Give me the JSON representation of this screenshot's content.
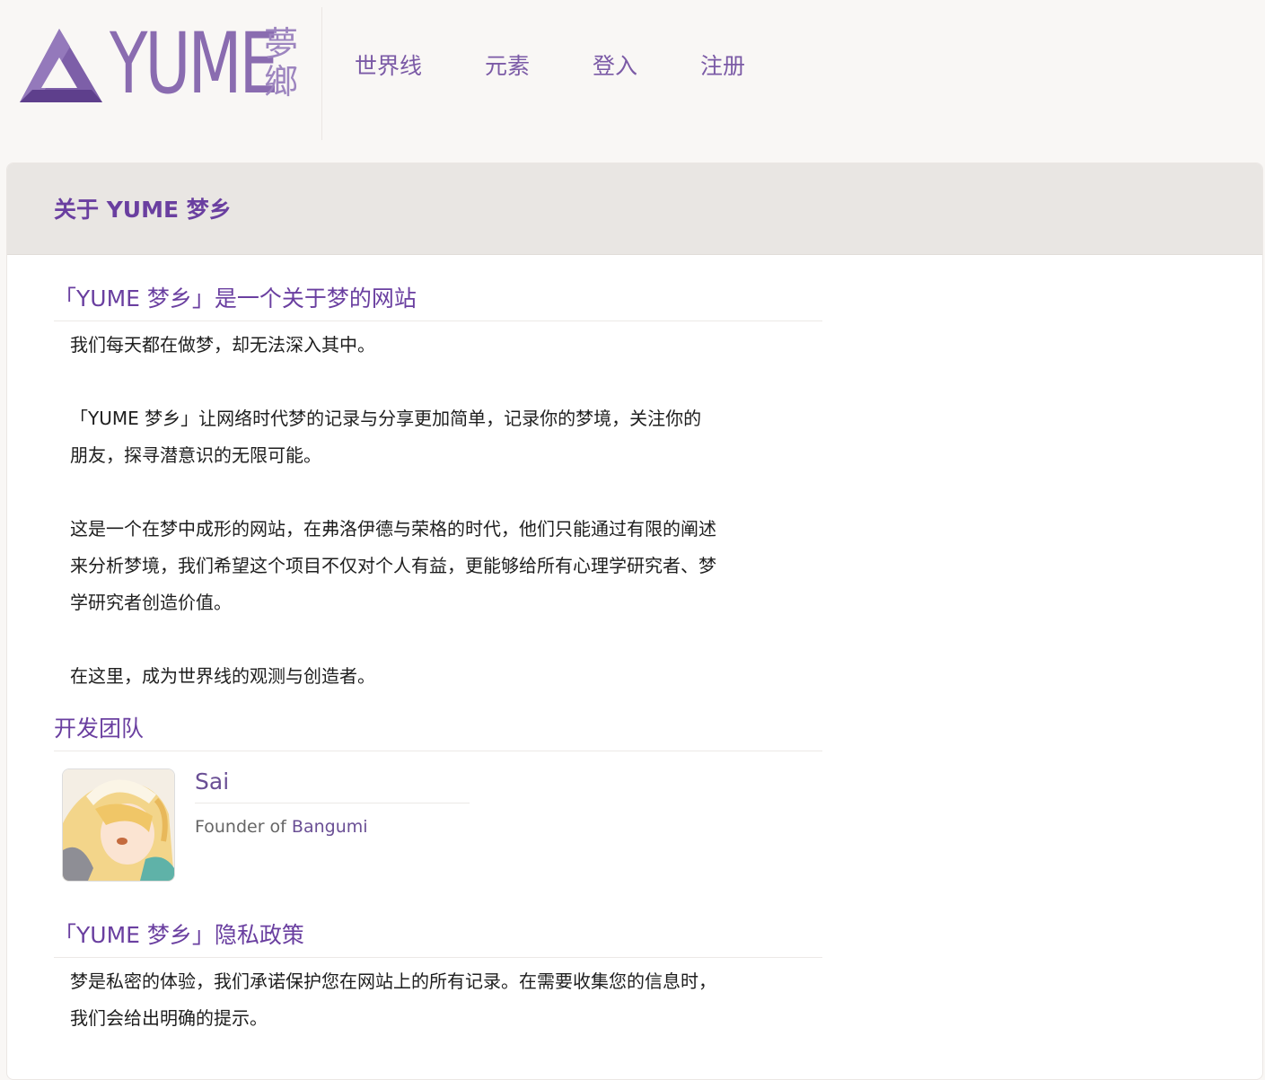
{
  "logo": {
    "word": "YUME",
    "cn_top": "夢",
    "cn_bottom": "鄉"
  },
  "nav": {
    "items": [
      "世界线",
      "元素",
      "登入",
      "注册"
    ]
  },
  "card": {
    "title": "关于 YUME 梦乡"
  },
  "about": {
    "title": "「YUME 梦乡」是一个关于梦的网站",
    "p1": "我们每天都在做梦，却无法深入其中。",
    "p2_line1": "「YUME 梦乡」让网络时代梦的记录与分享更加简单，记录你的梦境，关注你的",
    "p2_line2": "朋友，探寻潜意识的无限可能。",
    "p3_line1": "这是一个在梦中成形的网站，在弗洛伊德与荣格的时代，他们只能通过有限的阐述",
    "p3_line2": "来分析梦境，我们希望这个项目不仅对个人有益，更能够给所有心理学研究者、梦",
    "p3_line3": "学研究者创造价值。",
    "p4": "在这里，成为世界线的观测与创造者。"
  },
  "team": {
    "title": "开发团队",
    "members": [
      {
        "name": "Sai",
        "role_prefix": "Founder of ",
        "role_link": "Bangumi"
      }
    ]
  },
  "privacy": {
    "title": "「YUME 梦乡」隐私政策",
    "line1": "梦是私密的体验，我们承诺保护您在网站上的所有记录。在需要收集您的信息时，",
    "line2": "我们会给出明确的提示。"
  },
  "colors": {
    "accent": "#6a3fa0",
    "logo": "#8a6cb0",
    "nav": "#7b5aa6",
    "page_bg": "#f9f7f5",
    "card_head_bg": "#e9e6e3"
  }
}
